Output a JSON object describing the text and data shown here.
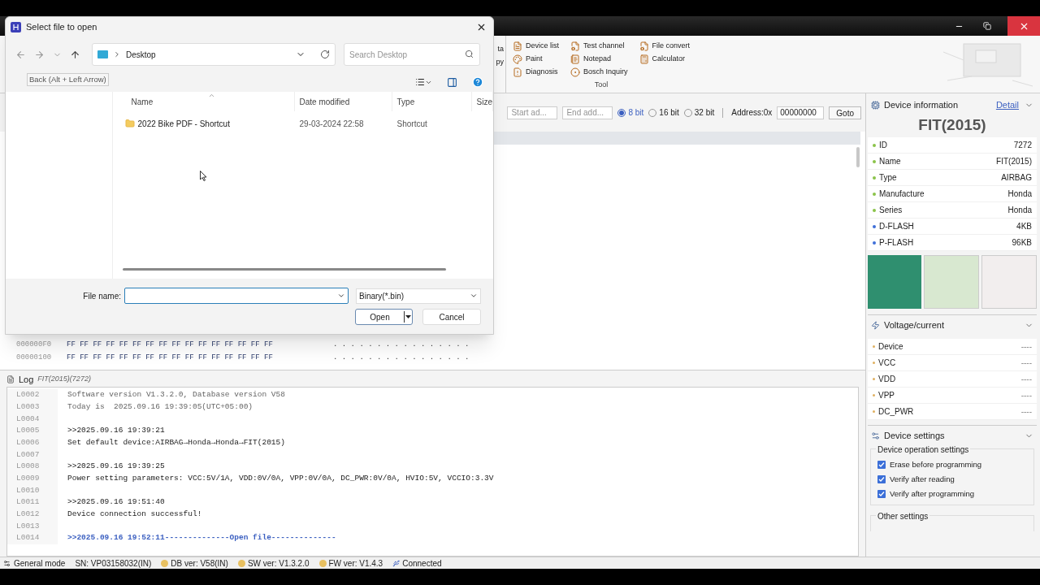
{
  "ribbon": {
    "partial_labels": [
      "ta",
      "py"
    ],
    "tool_group": {
      "label": "Tool",
      "columns": [
        [
          {
            "label": "Device list",
            "kind": "list"
          },
          {
            "label": "Paint",
            "kind": "paint"
          },
          {
            "label": "Diagnosis",
            "kind": "diagnosis"
          }
        ],
        [
          {
            "label": "Test channel",
            "kind": "test"
          },
          {
            "label": "Notepad",
            "kind": "notepad"
          },
          {
            "label": "Bosch Inquiry",
            "kind": "bosch"
          }
        ],
        [
          {
            "label": "File convert",
            "kind": "convert"
          },
          {
            "label": "Calculator",
            "kind": "calculator"
          }
        ]
      ]
    }
  },
  "hex_toolbar": {
    "start_placeholder": "Start ad...",
    "end_placeholder": "End add...",
    "widths": [
      {
        "label": "8 bit",
        "selected": true
      },
      {
        "label": "16 bit",
        "selected": false
      },
      {
        "label": "32 bit",
        "selected": false
      }
    ],
    "address_label": "Address:0x",
    "address_value": "00000000",
    "goto": "Goto"
  },
  "hex_rows": [
    {
      "address": "000000F0",
      "bytes": "FF FF FF FF FF FF FF FF FF FF FF FF FF FF FF FF",
      "ascii": ". . . . . . . . . . . . . . . ."
    },
    {
      "address": "00000100",
      "bytes": "FF FF FF FF FF FF FF FF FF FF FF FF FF FF FF FF",
      "ascii": ". . . . . . . . . . . . . . . ."
    }
  ],
  "log": {
    "title": "Log",
    "subtitle": "FIT(2015)(7272)",
    "lines": [
      {
        "number": "L0002",
        "text": "Software version V1.3.2.0, Database version V58",
        "kind": "info"
      },
      {
        "number": "L0003",
        "text": "Today is  2025.09.16 19:39:05(UTC+05:00)",
        "kind": "info"
      },
      {
        "number": "L0004"
      },
      {
        "number": "L0005",
        "text": ">>2025.09.16 19:39:21",
        "kind": "normal"
      },
      {
        "number": "L0006",
        "text": "Set default device:AIRBAG→Honda→Honda→FIT(2015)",
        "kind": "normal"
      },
      {
        "number": "L0007"
      },
      {
        "number": "L0008",
        "text": ">>2025.09.16 19:39:25",
        "kind": "normal"
      },
      {
        "number": "L0009",
        "text": "Power setting parameters: VCC:5V/1A, VDD:0V/0A, VPP:0V/0A, DC_PWR:0V/0A, HVIO:5V, VCCIO:3.3V",
        "kind": "normal"
      },
      {
        "number": "L0010"
      },
      {
        "number": "L0011",
        "text": ">>2025.09.16 19:51:40",
        "kind": "normal"
      },
      {
        "number": "L0012",
        "text": "Device connection successful!",
        "kind": "normal"
      },
      {
        "number": "L0013"
      },
      {
        "number": "L0014",
        "text": ">>2025.09.16 19:52:11--------------Open file--------------",
        "kind": "highlight"
      }
    ]
  },
  "device_info": {
    "title": "Device information",
    "detail_link": "Detail",
    "device_name": "FIT(2015)",
    "rows": [
      {
        "label": "ID",
        "value": "7272",
        "color": "#8bc34a"
      },
      {
        "label": "Name",
        "value": "FIT(2015)",
        "color": "#8bc34a"
      },
      {
        "label": "Type",
        "value": "AIRBAG",
        "color": "#8bc34a"
      },
      {
        "label": "Manufacture",
        "value": "Honda",
        "color": "#8bc34a"
      },
      {
        "label": "Series",
        "value": "Honda",
        "color": "#8bc34a"
      },
      {
        "label": "D-FLASH",
        "value": "4KB",
        "color": "#3f6fd8"
      },
      {
        "label": "P-FLASH",
        "value": "96KB",
        "color": "#3f6fd8"
      }
    ]
  },
  "voltage": {
    "title": "Voltage/current",
    "rows": [
      {
        "label": "Device",
        "value": "----"
      },
      {
        "label": "VCC",
        "value": "----"
      },
      {
        "label": "VDD",
        "value": "----"
      },
      {
        "label": "VPP",
        "value": "----"
      },
      {
        "label": "DC_PWR",
        "value": "----"
      }
    ]
  },
  "device_settings": {
    "title": "Device settings",
    "operation_group": "Device operation settings",
    "options": [
      {
        "label": "Erase before programming",
        "checked": true
      },
      {
        "label": "Verify after reading",
        "checked": true
      },
      {
        "label": "Verify after programming",
        "checked": true
      }
    ],
    "other_group": "Other settings"
  },
  "status_bar": {
    "mode": "General mode",
    "serial": "SN:  VP03158032(IN)",
    "db": "DB ver: V58(IN)",
    "sw": "SW ver: V1.3.2.0",
    "fw": "FW ver: V1.4.3",
    "connection": "Connected"
  },
  "dialog": {
    "title": "Select file to open",
    "location": "Desktop",
    "search_placeholder": "Search Desktop",
    "tooltip": "Back (Alt + Left Arrow)",
    "columns": [
      "Name",
      "Date modified",
      "Type",
      "Size"
    ],
    "files": [
      {
        "name": "2022 Bike PDF - Shortcut",
        "date": "29-03-2024 22:58",
        "type": "Shortcut"
      }
    ],
    "file_name_label": "File name:",
    "filter": "Binary(*.bin)",
    "open": "Open",
    "cancel": "Cancel"
  }
}
